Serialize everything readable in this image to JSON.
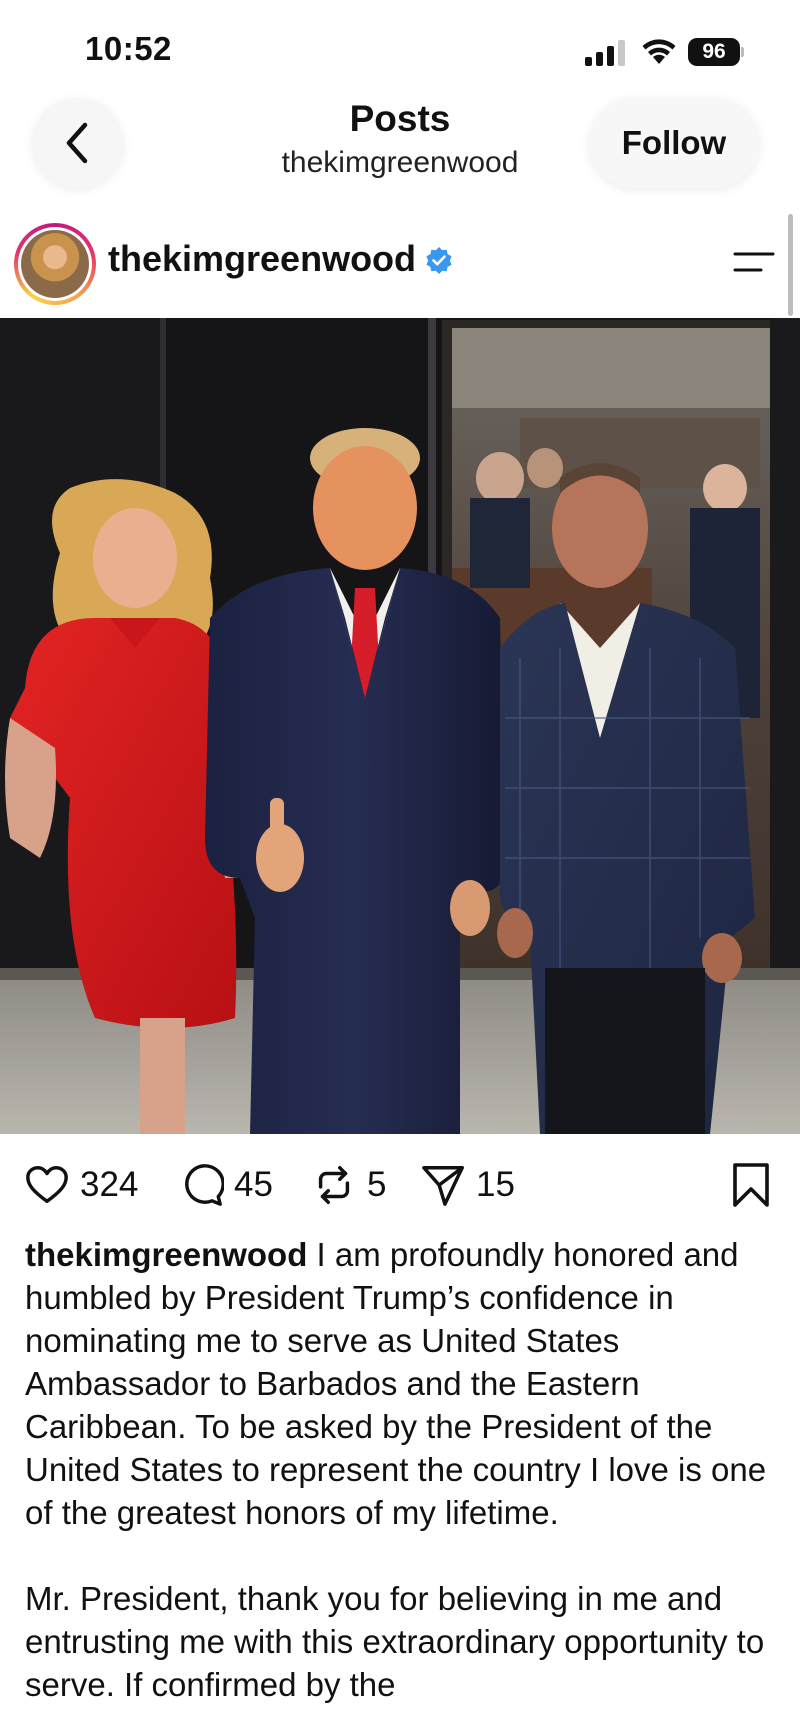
{
  "status_bar": {
    "time": "10:52",
    "battery": "96"
  },
  "header": {
    "title": "Posts",
    "subtitle": "thekimgreenwood",
    "follow_label": "Follow"
  },
  "post": {
    "username": "thekimgreenwood",
    "verified": true,
    "likes": "324",
    "comments": "45",
    "reposts": "5",
    "shares": "15",
    "caption_text": " I am profoundly honored and humbled by President Trump’s confidence in nominating me to serve as United States Ambassador to Barbados and the Eastern Caribbean. To be asked by the President of the United States to represent the country I love is one of the greatest honors of my lifetime.",
    "caption_text_2": "Mr. President, thank you for believing in me and entrusting me with this extraordinary opportunity to serve. If confirmed by the"
  },
  "icons": {
    "back": "chevron-left-icon",
    "menu": "menu-icon",
    "like": "heart-icon",
    "comment": "comment-icon",
    "repost": "repost-icon",
    "share": "send-icon",
    "save": "bookmark-icon",
    "verified": "verified-badge-icon"
  },
  "colors": {
    "verified_blue": "#3897f0",
    "text": "#111111"
  }
}
